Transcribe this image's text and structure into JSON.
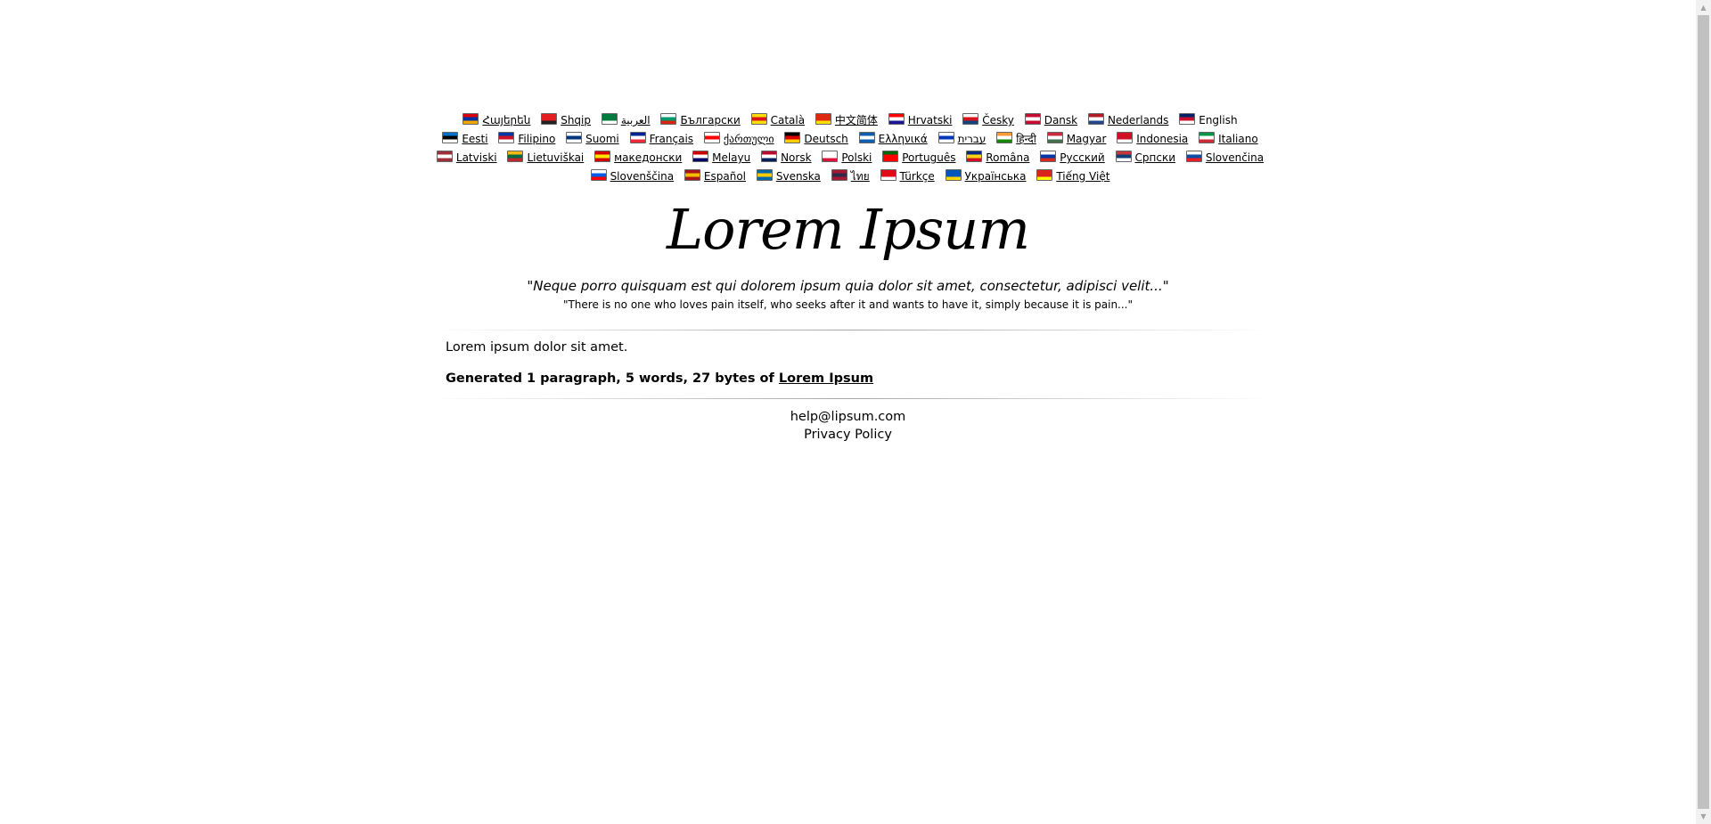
{
  "languages": [
    {
      "label": "Հայերեն",
      "flag": [
        "#d90012",
        "#0033a0",
        "#f2a800"
      ]
    },
    {
      "label": "Shqip",
      "flag": [
        "#e41e20",
        "#e41e20",
        "#222"
      ]
    },
    {
      "label": "العربية",
      "flag": [
        "#007a3d",
        "#007a3d",
        "#fff"
      ]
    },
    {
      "label": "Български",
      "flag": [
        "#fff",
        "#00966e",
        "#d62612"
      ]
    },
    {
      "label": "Català",
      "flag": [
        "#fcdd09",
        "#da121a",
        "#fcdd09"
      ]
    },
    {
      "label": "中文简体",
      "flag": [
        "#de2910",
        "#de2910",
        "#ffde00"
      ]
    },
    {
      "label": "Hrvatski",
      "flag": [
        "#ff0000",
        "#fff",
        "#171796"
      ]
    },
    {
      "label": "Česky",
      "flag": [
        "#fff",
        "#d7141a",
        "#11457e"
      ]
    },
    {
      "label": "Dansk",
      "flag": [
        "#c60c30",
        "#fff",
        "#c60c30"
      ]
    },
    {
      "label": "Nederlands",
      "flag": [
        "#ae1c28",
        "#fff",
        "#21468b"
      ]
    },
    {
      "label": "English",
      "flag": [
        "#012169",
        "#c8102e",
        "#fff"
      ]
    },
    {
      "label": "Eesti",
      "flag": [
        "#0072ce",
        "#000",
        "#fff"
      ]
    },
    {
      "label": "Filipino",
      "flag": [
        "#0038a8",
        "#ce1126",
        "#fff"
      ]
    },
    {
      "label": "Suomi",
      "flag": [
        "#fff",
        "#003580",
        "#fff"
      ]
    },
    {
      "label": "Français",
      "flag": [
        "#002395",
        "#fff",
        "#ed2939"
      ]
    },
    {
      "label": "ქართული",
      "flag": [
        "#fff",
        "#ff0000",
        "#fff"
      ]
    },
    {
      "label": "Deutsch",
      "flag": [
        "#000",
        "#dd0000",
        "#ffce00"
      ]
    },
    {
      "label": "Ελληνικά",
      "flag": [
        "#0d5eaf",
        "#fff",
        "#0d5eaf"
      ]
    },
    {
      "label": "עברית",
      "flag": [
        "#fff",
        "#0038b8",
        "#fff"
      ]
    },
    {
      "label": "हिन्दी",
      "flag": [
        "#ff9933",
        "#fff",
        "#138808"
      ]
    },
    {
      "label": "Magyar",
      "flag": [
        "#cd2a3e",
        "#fff",
        "#436f4d"
      ]
    },
    {
      "label": "Indonesia",
      "flag": [
        "#ce1126",
        "#ce1126",
        "#fff"
      ]
    },
    {
      "label": "Italiano",
      "flag": [
        "#009246",
        "#fff",
        "#ce2b37"
      ]
    },
    {
      "label": "Latviski",
      "flag": [
        "#9e3039",
        "#fff",
        "#9e3039"
      ]
    },
    {
      "label": "Lietuviškai",
      "flag": [
        "#fdb913",
        "#006a44",
        "#c1272d"
      ]
    },
    {
      "label": "македонски",
      "flag": [
        "#d20000",
        "#ffe600",
        "#d20000"
      ]
    },
    {
      "label": "Melayu",
      "flag": [
        "#cc0001",
        "#fff",
        "#010066"
      ]
    },
    {
      "label": "Norsk",
      "flag": [
        "#ba0c2f",
        "#fff",
        "#00205b"
      ]
    },
    {
      "label": "Polski",
      "flag": [
        "#fff",
        "#fff",
        "#dc143c"
      ]
    },
    {
      "label": "Português",
      "flag": [
        "#006600",
        "#ff0000",
        "#ff0000"
      ]
    },
    {
      "label": "Româna",
      "flag": [
        "#002b7f",
        "#fcd116",
        "#ce1126"
      ]
    },
    {
      "label": "Pyccкий",
      "flag": [
        "#fff",
        "#0039a6",
        "#d52b1e"
      ]
    },
    {
      "label": "Српски",
      "flag": [
        "#c6363c",
        "#0c4076",
        "#fff"
      ]
    },
    {
      "label": "Slovenčina",
      "flag": [
        "#fff",
        "#0b4ea2",
        "#ee1c25"
      ]
    },
    {
      "label": "Slovenščina",
      "flag": [
        "#fff",
        "#005ce5",
        "#ff0000"
      ]
    },
    {
      "label": "Español",
      "flag": [
        "#aa151b",
        "#f1bf00",
        "#aa151b"
      ]
    },
    {
      "label": "Svenska",
      "flag": [
        "#006aa7",
        "#fecc00",
        "#006aa7"
      ]
    },
    {
      "label": "ไทย",
      "flag": [
        "#a51931",
        "#2d2a4a",
        "#a51931"
      ]
    },
    {
      "label": "Türkçe",
      "flag": [
        "#e30a17",
        "#e30a17",
        "#fff"
      ]
    },
    {
      "label": "Українська",
      "flag": [
        "#0057b7",
        "#0057b7",
        "#ffd700"
      ]
    },
    {
      "label": "Tiếng Việt",
      "flag": [
        "#da251d",
        "#da251d",
        "#ffff00"
      ]
    }
  ],
  "current_language": "English",
  "title": "Lorem Ipsum",
  "quote": "\"Neque porro quisquam est qui dolorem ipsum quia dolor sit amet, consectetur, adipisci velit...\"",
  "quote_translation": "\"There is no one who loves pain itself, who seeks after it and wants to have it, simply because it is pain...\"",
  "lipsum_text": "Lorem ipsum dolor sit amet.",
  "generated": {
    "prefix": "Generated 1 paragraph, 5 words, 27 bytes of ",
    "link": "Lorem Ipsum"
  },
  "footer": {
    "email": "help@lipsum.com",
    "privacy": "Privacy Policy"
  }
}
